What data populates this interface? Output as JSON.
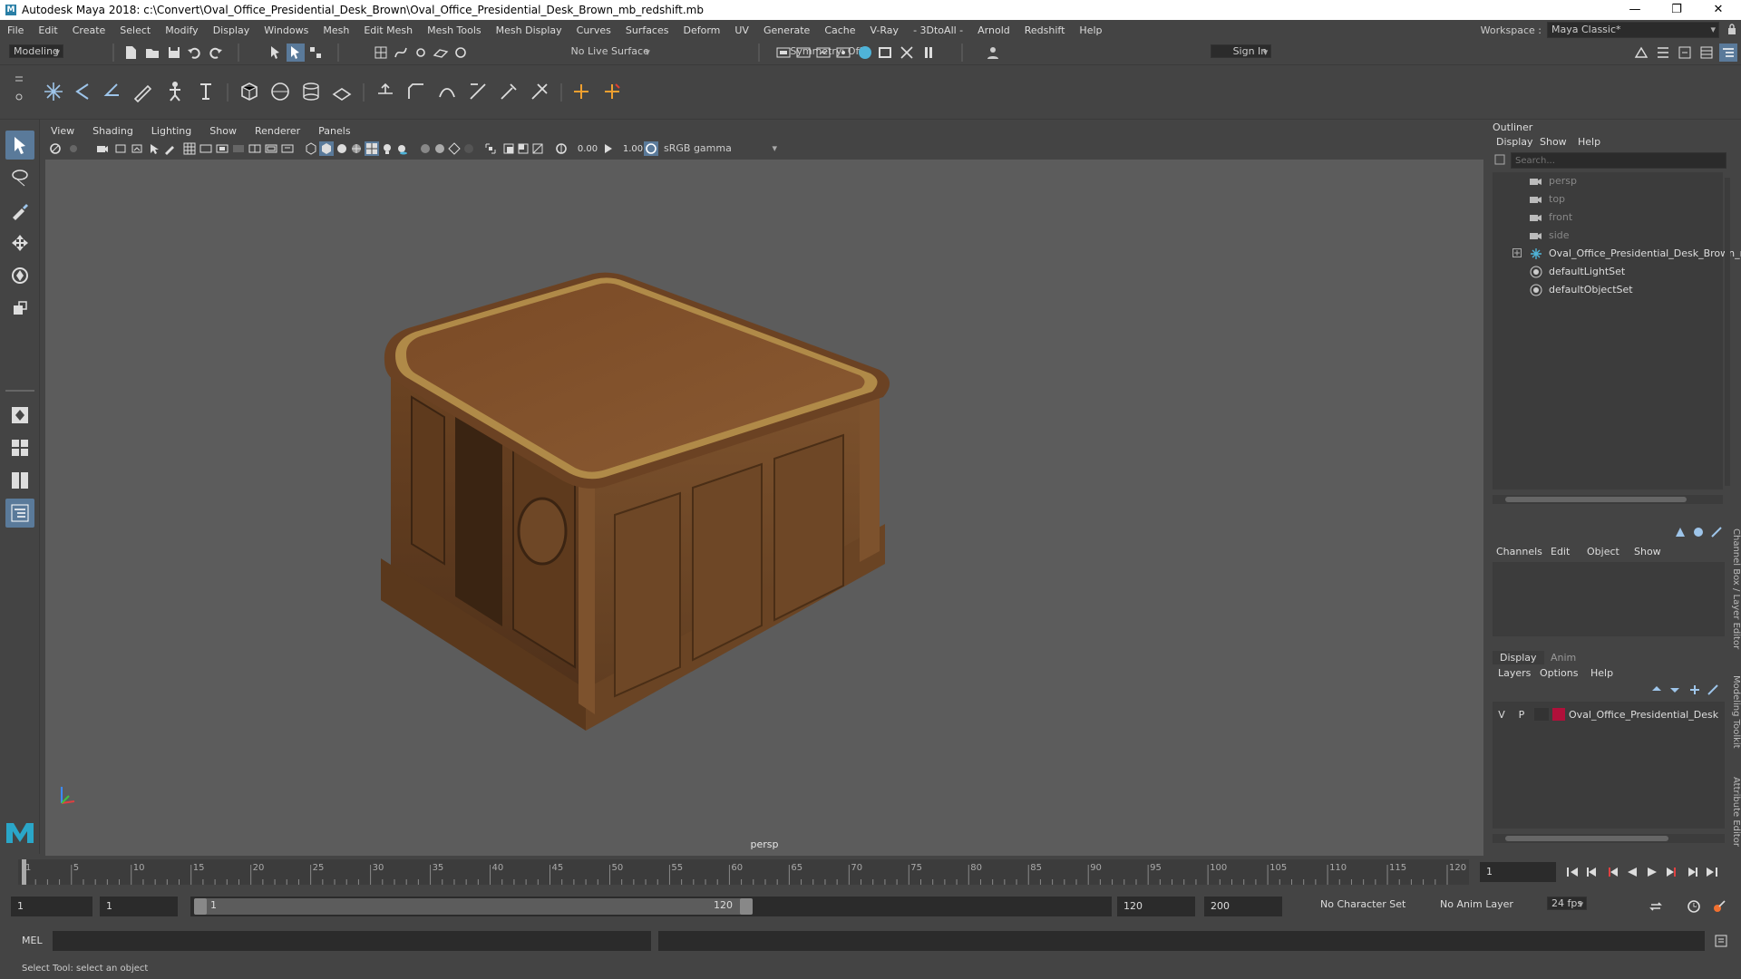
{
  "window": {
    "title": "Autodesk Maya 2018: c:\\Convert\\Oval_Office_Presidential_Desk_Brown\\Oval_Office_Presidential_Desk_Brown_mb_redshift.mb",
    "logo": "M"
  },
  "menubar": {
    "items": [
      "File",
      "Edit",
      "Create",
      "Select",
      "Modify",
      "Display",
      "Windows",
      "Mesh",
      "Edit Mesh",
      "Mesh Tools",
      "Mesh Display",
      "Curves",
      "Surfaces",
      "Deform",
      "UV",
      "Generate",
      "Cache",
      "V-Ray",
      "- 3DtoAll -",
      "Arnold",
      "Redshift",
      "Help"
    ],
    "workspace_label": "Workspace :",
    "workspace_value": "Maya Classic*"
  },
  "statusline": {
    "mode": "Modeling",
    "live_surface": "No Live Surface",
    "symmetry": "Symmetry: Off",
    "sign_in": "Sign In"
  },
  "viewport": {
    "menus": [
      "View",
      "Shading",
      "Lighting",
      "Show",
      "Renderer",
      "Panels"
    ],
    "exposure": "0.00",
    "gamma": "1.00",
    "color_space": "sRGB gamma",
    "camera": "persp"
  },
  "outliner": {
    "title": "Outliner",
    "menus": [
      "Display",
      "Show",
      "Help"
    ],
    "search_placeholder": "Search...",
    "items": [
      {
        "label": "persp",
        "icon": "camera-icon"
      },
      {
        "label": "top",
        "icon": "camera-icon"
      },
      {
        "label": "front",
        "icon": "camera-icon"
      },
      {
        "label": "side",
        "icon": "camera-icon"
      },
      {
        "label": "Oval_Office_Presidential_Desk_Brown_n",
        "icon": "group-icon"
      },
      {
        "label": "defaultLightSet",
        "icon": "set-icon"
      },
      {
        "label": "defaultObjectSet",
        "icon": "set-icon"
      }
    ]
  },
  "channelbox": {
    "menus": [
      "Channels",
      "Edit",
      "Object",
      "Show"
    ],
    "tabs": [
      "Display",
      "Anim"
    ],
    "layer_menus": [
      "Layers",
      "Options",
      "Help"
    ],
    "layer": {
      "v": "V",
      "p": "P",
      "name": "Oval_Office_Presidential_Desk",
      "color": "#b0103a"
    }
  },
  "side_tabs": [
    "Channel Box / Layer Editor",
    "Modeling Toolkit",
    "Attribute Editor"
  ],
  "timeline": {
    "ticks": [
      "1",
      "5",
      "10",
      "15",
      "20",
      "25",
      "30",
      "35",
      "40",
      "45",
      "50",
      "55",
      "60",
      "65",
      "70",
      "75",
      "80",
      "85",
      "90",
      "95",
      "100",
      "105",
      "110",
      "115",
      "120"
    ],
    "current_frame": "1"
  },
  "range": {
    "start": "1",
    "playback_start": "1",
    "slider_start": "1",
    "slider_end": "120",
    "playback_end": "120",
    "end": "200",
    "character_set": "No Character Set",
    "anim_layer": "No Anim Layer",
    "fps": "24 fps"
  },
  "cmdline": {
    "label": "MEL"
  },
  "helpline": {
    "text": "Select Tool: select an object"
  }
}
